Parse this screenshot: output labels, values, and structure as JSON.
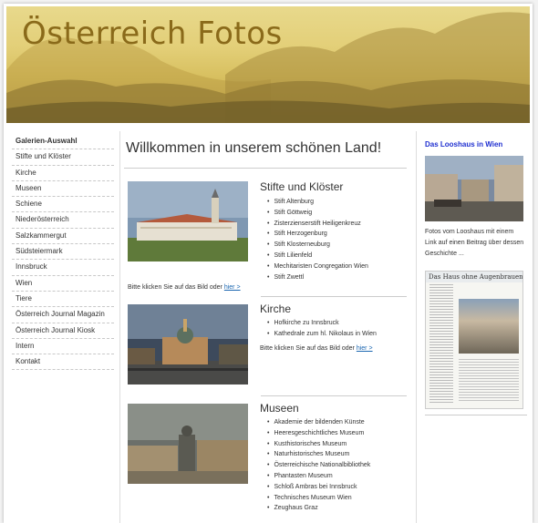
{
  "header": {
    "title": "Österreich Fotos"
  },
  "sidebar": {
    "items": [
      {
        "label": "Galerien-Auswahl"
      },
      {
        "label": "Stifte und Klöster"
      },
      {
        "label": "Kirche"
      },
      {
        "label": "Museen"
      },
      {
        "label": "Schiene"
      },
      {
        "label": "Niederösterreich"
      },
      {
        "label": "Salzkammergut"
      },
      {
        "label": "Südsteiermark"
      },
      {
        "label": "Innsbruck"
      },
      {
        "label": "Wien"
      },
      {
        "label": "Tiere"
      },
      {
        "label": "Österreich Journal Magazin"
      },
      {
        "label": "Österreich Journal Kiosk"
      },
      {
        "label": "Intern"
      },
      {
        "label": "Kontakt"
      }
    ]
  },
  "main": {
    "welcome": "Willkommen in unserem schönen Land!",
    "click_prefix": "Bitte klicken Sie auf das Bild oder",
    "click_link": "hier >",
    "sections": [
      {
        "title": "Stifte und Klöster",
        "items": [
          "Stift Altenburg",
          "Stift Göttweig",
          "Zisterzienserstift Heiligenkreuz",
          "Stift Herzogenburg",
          "Stift Klosterneuburg",
          "Stift Lilienfeld",
          "Mechitaristen Congregation Wien",
          "Stift Zwettl"
        ]
      },
      {
        "title": "Kirche",
        "items": [
          "Hofkirche zu Innsbruck",
          "Kathedrale zum hl. Nikolaus in Wien"
        ]
      },
      {
        "title": "Museen",
        "items": [
          "Akademie der bildenden Künste",
          "Heeresgeschichtliches Museum",
          "Kusthistorisches Museum",
          "Naturhistorisches Museum",
          "Österreichische Nationalbibliothek",
          "Phantasten Museum",
          "Schloß Ambras bei Innsbruck",
          "Technisches Museum Wien",
          "Zeughaus Graz"
        ]
      }
    ]
  },
  "aside": {
    "title": "Das Looshaus in Wien",
    "text": "Fotos vom Looshaus mit einem Link auf einen Beitrag über dessen Geschichte ...",
    "article_headline": "Das Haus ohne Augenbrauen"
  }
}
